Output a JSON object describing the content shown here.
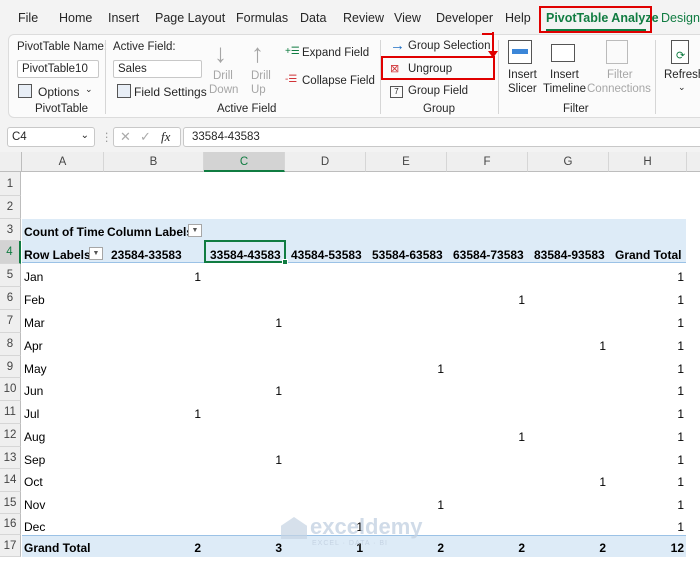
{
  "menu": {
    "tabs": [
      "File",
      "Home",
      "Insert",
      "Page Layout",
      "Formulas",
      "Data",
      "Review",
      "View",
      "Developer",
      "Help",
      "PivotTable Analyze",
      "Design"
    ],
    "active_tab": "PivotTable Analyze"
  },
  "ribbon": {
    "pivottable": {
      "name_label": "PivotTable Name:",
      "name_value": "PivotTable10",
      "options_label": "Options",
      "group_label": "PivotTable"
    },
    "active_field": {
      "label": "Active Field:",
      "value": "Sales",
      "field_settings": "Field Settings",
      "drill_down": [
        "Drill",
        "Down"
      ],
      "drill_up": [
        "Drill",
        "Up"
      ],
      "expand_field": "Expand Field",
      "collapse_field": "Collapse Field",
      "group_label": "Active Field"
    },
    "group": {
      "group_selection": "Group Selection",
      "ungroup": "Ungroup",
      "group_field": "Group Field",
      "group_label": "Group"
    },
    "filter": {
      "insert_slicer": [
        "Insert",
        "Slicer"
      ],
      "insert_timeline": [
        "Insert",
        "Timeline"
      ],
      "filter_connections": [
        "Filter",
        "Connections"
      ],
      "group_label": "Filter"
    },
    "refresh": "Refresh"
  },
  "formula_bar": {
    "name_box": "C4",
    "fx": "fx",
    "formula": "33584-43583"
  },
  "sheet": {
    "columns": [
      "A",
      "B",
      "C",
      "D",
      "E",
      "F",
      "G",
      "H"
    ],
    "selected_column": "C",
    "rows": [
      "1",
      "2",
      "3",
      "4",
      "5",
      "6",
      "7",
      "8",
      "9",
      "10",
      "11",
      "12",
      "13",
      "14",
      "15",
      "16",
      "17"
    ],
    "pivot": {
      "count_label": "Count of Time",
      "column_labels": "Column Labels",
      "row_labels": "Row Labels",
      "headers": [
        "23584-33583",
        "33584-43583",
        "43584-53583",
        "53584-63583",
        "63584-73583",
        "83584-93583",
        "Grand Total"
      ],
      "data_rows": [
        {
          "label": "Jan",
          "values": [
            "1",
            "",
            "",
            "",
            "",
            "",
            "1"
          ]
        },
        {
          "label": "Feb",
          "values": [
            "",
            "",
            "",
            "",
            "1",
            "",
            "1"
          ]
        },
        {
          "label": "Mar",
          "values": [
            "",
            "1",
            "",
            "",
            "",
            "",
            "1"
          ]
        },
        {
          "label": "Apr",
          "values": [
            "",
            "",
            "",
            "",
            "",
            "1",
            "1"
          ]
        },
        {
          "label": "May",
          "values": [
            "",
            "",
            "",
            "1",
            "",
            "",
            "1"
          ]
        },
        {
          "label": "Jun",
          "values": [
            "",
            "1",
            "",
            "",
            "",
            "",
            "1"
          ]
        },
        {
          "label": "Jul",
          "values": [
            "1",
            "",
            "",
            "",
            "",
            "",
            "1"
          ]
        },
        {
          "label": "Aug",
          "values": [
            "",
            "",
            "",
            "",
            "1",
            "",
            "1"
          ]
        },
        {
          "label": "Sep",
          "values": [
            "",
            "1",
            "",
            "",
            "",
            "",
            "1"
          ]
        },
        {
          "label": "Oct",
          "values": [
            "",
            "",
            "",
            "",
            "",
            "1",
            "1"
          ]
        },
        {
          "label": "Nov",
          "values": [
            "",
            "",
            "",
            "1",
            "",
            "",
            "1"
          ]
        },
        {
          "label": "Dec",
          "values": [
            "",
            "",
            "1",
            "",
            "",
            "",
            "1"
          ]
        }
      ],
      "grand_total": {
        "label": "Grand Total",
        "values": [
          "2",
          "3",
          "1",
          "2",
          "2",
          "2",
          "12"
        ]
      }
    }
  },
  "watermark": {
    "title": "exceldemy",
    "subtitle": "EXCEL · DATA · BI"
  }
}
